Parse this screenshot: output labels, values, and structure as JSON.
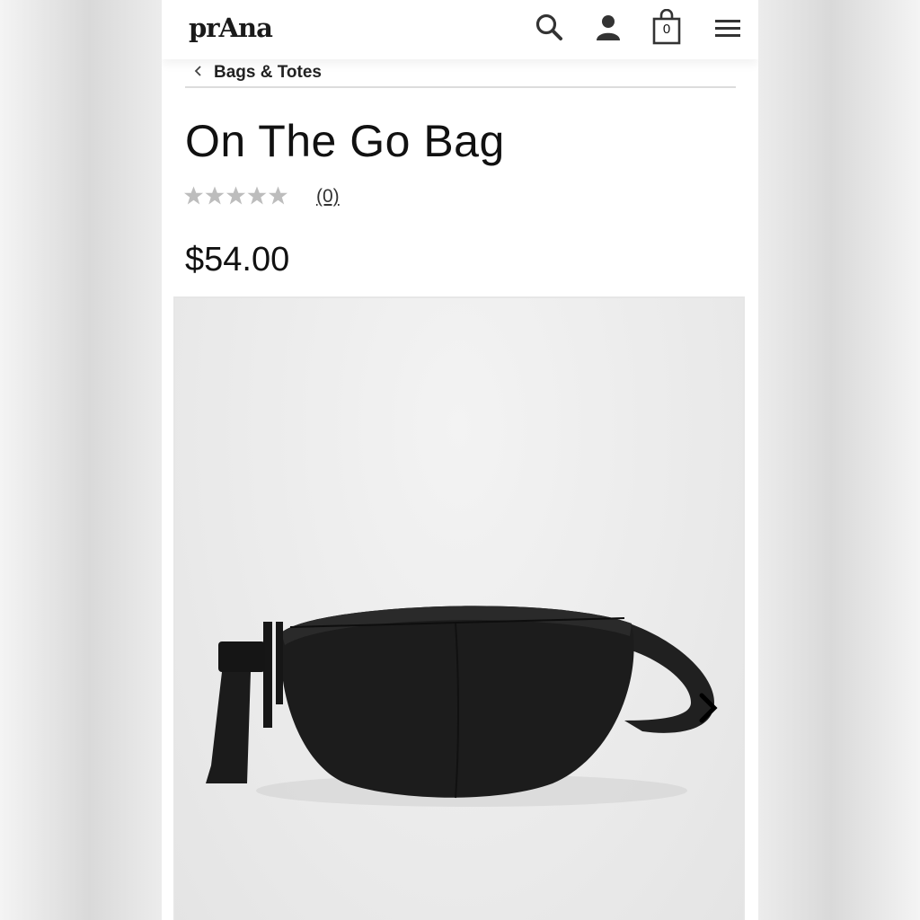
{
  "header": {
    "logo": "prAna",
    "cart_count": "0"
  },
  "breadcrumb": {
    "label": "Bags & Totes"
  },
  "product": {
    "title": "On The Go Bag",
    "rating_stars": 0,
    "review_count": "(0)",
    "price": "$54.00"
  },
  "colors": {
    "star_empty": "#bdbdbd",
    "text": "#111111",
    "bag": "#1c1c1c"
  }
}
